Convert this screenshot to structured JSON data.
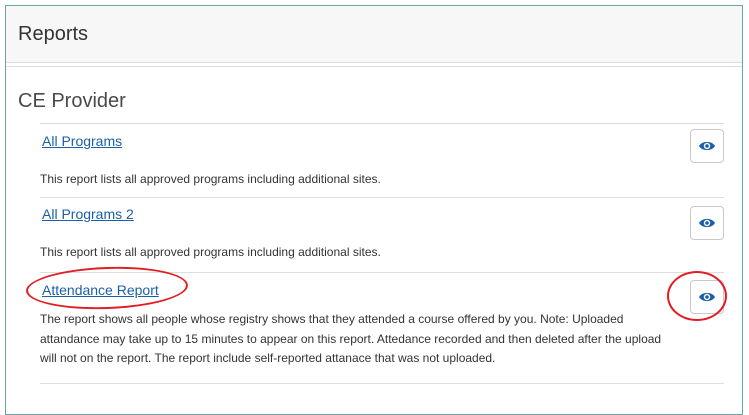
{
  "panel": {
    "title": "Reports"
  },
  "section": {
    "title": "CE Provider"
  },
  "reports": [
    {
      "link_label": "All Programs",
      "description": "This report lists all approved programs including additional sites.",
      "view_icon": "eye-icon"
    },
    {
      "link_label": "All Programs 2",
      "description": "This report lists all approved programs including additional sites.",
      "view_icon": "eye-icon"
    },
    {
      "link_label": "Attendance Report",
      "description": "The report shows all people whose registry shows that they attended a course offered by you. Note: Uploaded attandance may take up to 15 minutes to appear on this report. Attedance recorded and then deleted after the upload will not on the report. The report include self-reported attanace that was not uploaded.",
      "view_icon": "eye-icon"
    }
  ],
  "colors": {
    "link": "#1a5fa8",
    "icon": "#1a5fa8",
    "annotation": "#e01e24",
    "panel_border": "#6fa3a3"
  }
}
